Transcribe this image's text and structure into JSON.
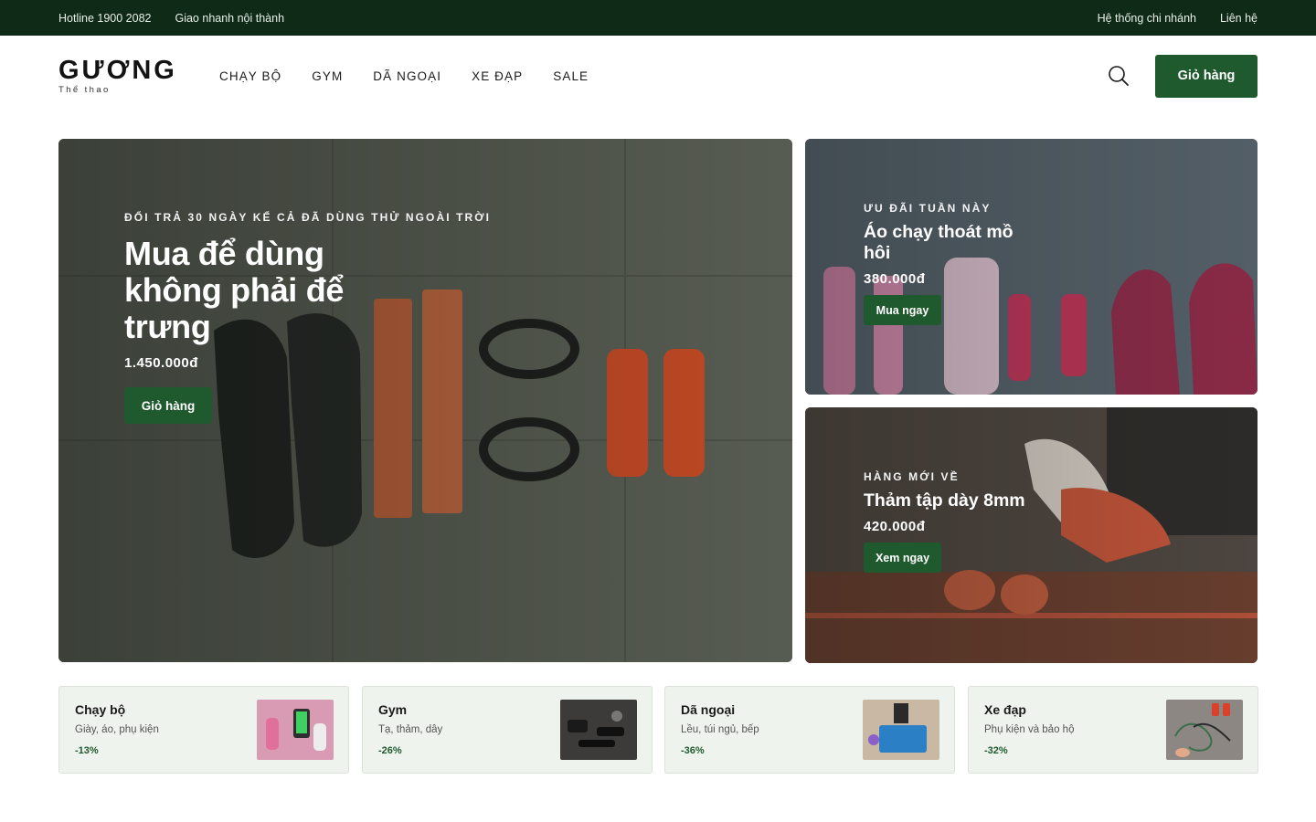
{
  "topbar": {
    "hotline": "Hotline 1900 2082",
    "delivery": "Giao nhanh nội thành",
    "stores": "Hệ thống chi nhánh",
    "contact": "Liên hệ"
  },
  "header": {
    "logo_word": "GƯƠNG",
    "logo_sub": "Thể thao",
    "nav": [
      "CHẠY BỘ",
      "GYM",
      "DÃ NGOẠI",
      "XE ĐẠP",
      "SALE"
    ],
    "cart_label": "Giỏ hàng",
    "icons": {
      "search": "search-icon"
    }
  },
  "hero": {
    "main": {
      "eyebrow": "ĐỔI TRẢ 30 NGÀY KỂ CẢ ĐÃ DÙNG THỬ NGOÀI TRỜI",
      "title": "Mua để dùng không phải để trưng",
      "price": "1.450.000đ",
      "button": "Giỏ hàng"
    },
    "top": {
      "eyebrow": "ƯU ĐÃI TUẦN NÀY",
      "title": "Áo chạy thoát mồ hôi",
      "price": "380.000đ",
      "button": "Mua ngay"
    },
    "bottom": {
      "eyebrow": "HÀNG MỚI VỀ",
      "title": "Thảm tập dày 8mm",
      "price": "420.000đ",
      "button": "Xem ngay"
    }
  },
  "categories": [
    {
      "name": "Chạy bộ",
      "desc": "Giày, áo, phụ kiện",
      "discount": "-13%"
    },
    {
      "name": "Gym",
      "desc": "Tạ, thảm, dây",
      "discount": "-26%"
    },
    {
      "name": "Dã ngoại",
      "desc": "Lều, túi ngủ, bếp",
      "discount": "-36%"
    },
    {
      "name": "Xe đạp",
      "desc": "Phụ kiện và bảo hộ",
      "discount": "-32%"
    }
  ],
  "colors": {
    "topbar_bg": "#0f2a17",
    "accent_green": "#1e5a2e",
    "tile_bg": "#eff3ee"
  }
}
